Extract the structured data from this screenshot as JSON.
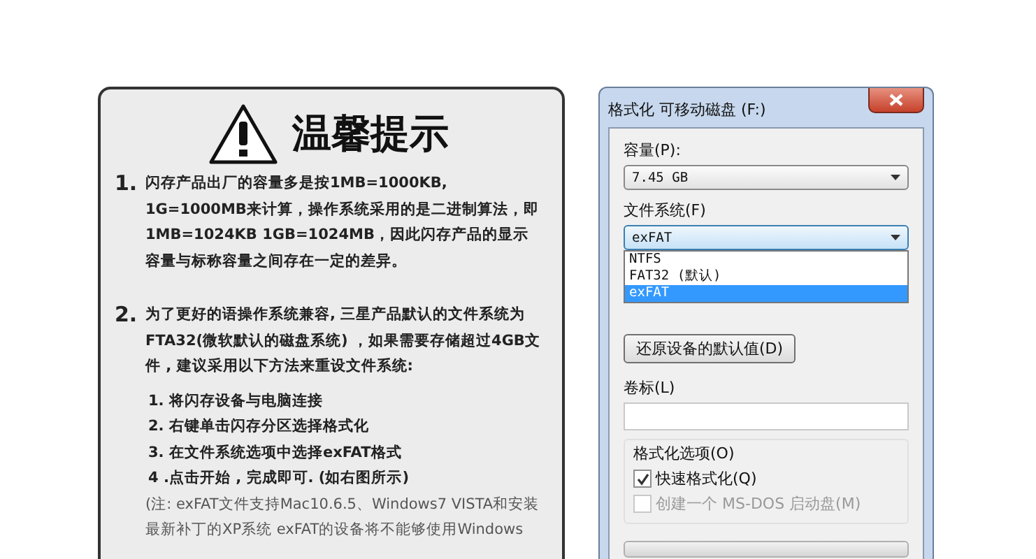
{
  "notice": {
    "title": "温馨提示",
    "items": [
      {
        "number": "1.",
        "text": "闪存产品出厂的容量多是按1MB=1000KB, 1G=1000MB来计算，操作系统采用的是二进制算法，即1MB=1024KB 1GB=1024MB，因此闪存产品的显示容量与标称容量之间存在一定的差异。"
      },
      {
        "number": "2.",
        "text": "为了更好的语操作系统兼容, 三星产品默认的文件系统为FTA32(微软默认的磁盘系统) ，如果需要存储超过4GB文件 , 建议采用以下方法来重设文件系统:",
        "steps": [
          "1. 将闪存设备与电脑连接",
          "2. 右键单击闪存分区选择格式化",
          "3. 在文件系统选项中选择exFAT格式",
          "4 .点击开始 , 完成即可. (如右图所示)"
        ],
        "note": "(注: exFAT文件支持Mac10.6.5、Windows7 VISTA和安装最新补丁的XP系统 exFAT的设备将不能够使用Windows"
      }
    ]
  },
  "dialog": {
    "title": "格式化 可移动磁盘 (F:)",
    "capacity": {
      "label": "容量(P):",
      "value": "7.45 GB"
    },
    "filesystem": {
      "label": "文件系统(F)",
      "value": "exFAT",
      "expanded": true,
      "options": [
        {
          "label": "NTFS",
          "selected": false
        },
        {
          "label": "FAT32 (默认)",
          "selected": false
        },
        {
          "label": "exFAT",
          "selected": true
        }
      ]
    },
    "restore_button": "还原设备的默认值(D)",
    "volume_label": {
      "label": "卷标(L)"
    },
    "format_options": {
      "title": "格式化选项(O)",
      "options": [
        {
          "label": "快速格式化(Q)",
          "checked": true,
          "disabled": false
        },
        {
          "label": "创建一个 MS-DOS 启动盘(M)",
          "checked": false,
          "disabled": true
        }
      ]
    },
    "progress": {
      "level": 0
    }
  }
}
